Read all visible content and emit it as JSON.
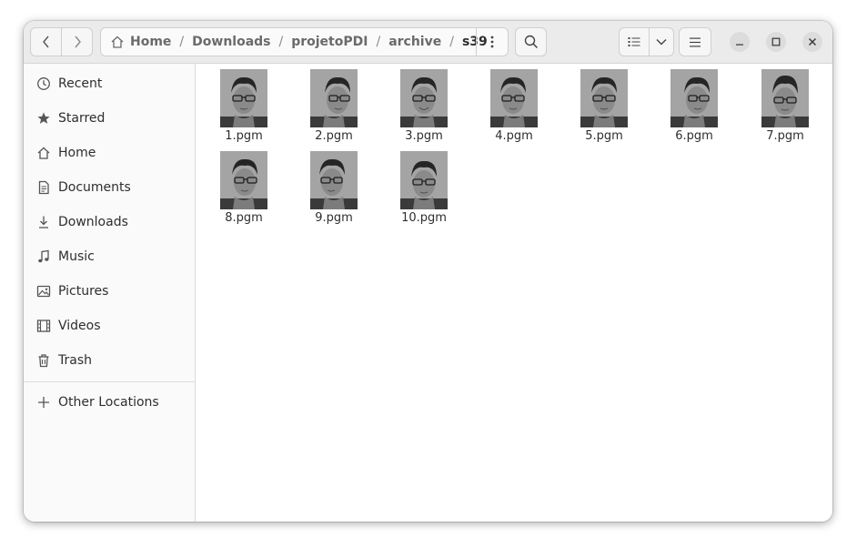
{
  "toolbar": {
    "back_icon": "chevron-left-icon",
    "forward_icon": "chevron-right-icon",
    "search_icon": "search-icon",
    "view_icon": "list-view-icon",
    "view_dropdown_icon": "chevron-down-icon",
    "menu_icon": "hamburger-menu-icon"
  },
  "path": {
    "home_icon": "home-icon",
    "crumbs": [
      "Home",
      "Downloads",
      "projetoPDI",
      "archive",
      "s39"
    ],
    "separator": "/"
  },
  "window_controls": {
    "minimize_icon": "minimize-icon",
    "maximize_icon": "maximize-icon",
    "close_icon": "close-icon"
  },
  "sidebar": {
    "items": [
      {
        "label": "Recent",
        "icon": "clock-icon"
      },
      {
        "label": "Starred",
        "icon": "star-icon"
      },
      {
        "label": "Home",
        "icon": "home-icon"
      },
      {
        "label": "Documents",
        "icon": "document-icon"
      },
      {
        "label": "Downloads",
        "icon": "download-icon"
      },
      {
        "label": "Music",
        "icon": "music-icon"
      },
      {
        "label": "Pictures",
        "icon": "picture-icon"
      },
      {
        "label": "Videos",
        "icon": "video-icon"
      },
      {
        "label": "Trash",
        "icon": "trash-icon"
      }
    ],
    "other_locations": {
      "label": "Other Locations",
      "icon": "plus-icon"
    }
  },
  "files": [
    {
      "name": "1.pgm"
    },
    {
      "name": "2.pgm"
    },
    {
      "name": "3.pgm"
    },
    {
      "name": "4.pgm"
    },
    {
      "name": "5.pgm"
    },
    {
      "name": "6.pgm"
    },
    {
      "name": "7.pgm"
    },
    {
      "name": "8.pgm"
    },
    {
      "name": "9.pgm"
    },
    {
      "name": "10.pgm"
    }
  ],
  "colors": {
    "headerbar": "#ebebeb",
    "sidebar": "#fafafa",
    "content": "#ffffff",
    "text": "#2e2e2e"
  }
}
